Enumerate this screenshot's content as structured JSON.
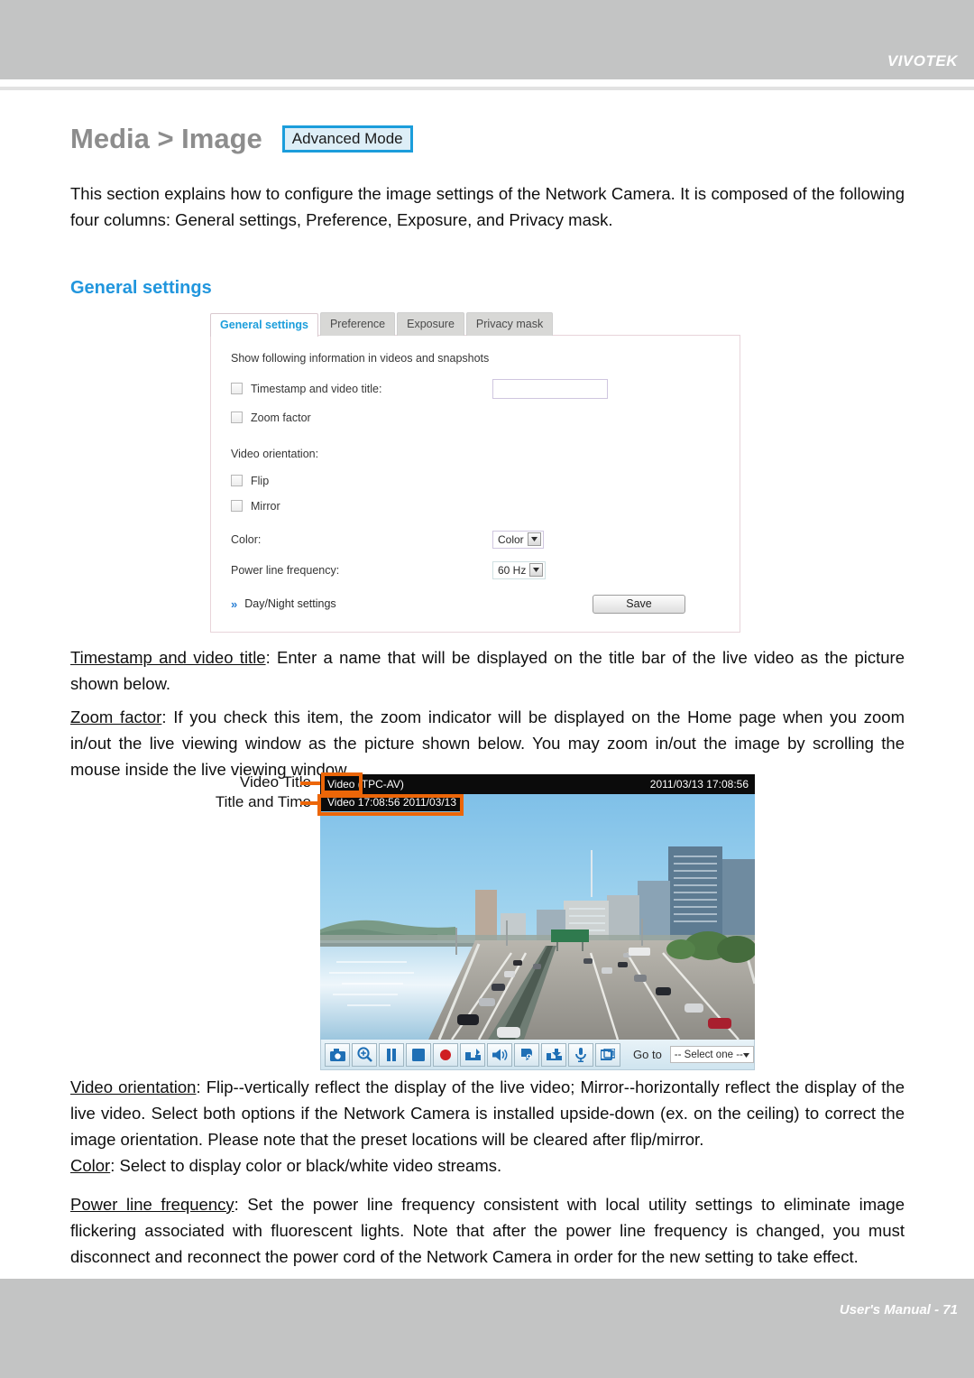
{
  "header": {
    "brand": "VIVOTEK"
  },
  "title": {
    "text": "Media > Image",
    "advanced_mode_button": "Advanced Mode",
    "accent_color": "#1b9ddb"
  },
  "intro_paragraph": "This section explains how to configure the image settings of the Network Camera. It is composed of the following four columns: General settings, Preference, Exposure, and Privacy mask.",
  "section_heading": "General settings",
  "settings_panel": {
    "tabs": [
      {
        "label": "General settings",
        "active": true
      },
      {
        "label": "Preference",
        "active": false
      },
      {
        "label": "Exposure",
        "active": false
      },
      {
        "label": "Privacy mask",
        "active": false
      }
    ],
    "info_label": "Show following information in videos and snapshots",
    "timestamp_checkbox_label": "Timestamp and video title:",
    "timestamp_input_value": "",
    "timestamp_input_placeholder": "",
    "zoom_factor_checkbox_label": "Zoom factor",
    "video_orientation_label": "Video orientation:",
    "flip_checkbox_label": "Flip",
    "mirror_checkbox_label": "Mirror",
    "color_label": "Color:",
    "color_value": "Color",
    "power_line_label": "Power line frequency:",
    "power_line_value": "60 Hz",
    "daynight_link": "Day/Night settings",
    "save_button": "Save"
  },
  "body": {
    "timestamp_term": "Timestamp and video title",
    "timestamp_text": ": Enter a name that will be displayed on the title bar of the live video as the picture shown below.",
    "zoom_term": "Zoom factor",
    "zoom_text": ": If you check this item, the zoom indicator will be displayed on the Home page when you zoom in/out the live viewing window as the picture shown below. You may zoom in/out the image by scrolling the mouse inside the live viewing window.",
    "orientation_term": "Video orientation",
    "orientation_text": ": Flip--vertically reflect the display of the live video; Mirror--horizontally reflect the display of the live video. Select both options if the Network Camera is installed upside-down (ex. on the ceiling) to correct the image orientation. Please note that the preset locations will be cleared after flip/mirror.",
    "color_term": "Color",
    "color_text": ": Select to display color or black/white video streams.",
    "power_term": "Power line frequency",
    "power_text": ": Set the power line frequency consistent with local utility settings to eliminate image flickering associated with fluorescent lights. Note that after the power line frequency is changed, you must disconnect and reconnect the power cord of the Network Camera in order for the new setting to take effect."
  },
  "live_figure": {
    "callout_video_title": "Video Title",
    "callout_title_and_time": "Title and Time",
    "titlebar_name": "Video (TPC-AV)",
    "titlebar_datetime": "2011/03/13  17:08:56",
    "osd_overlay": "Video 17:08:56  2011/03/13",
    "highlight_color": "#ec6608",
    "toolbar_buttons": [
      "snapshot-icon",
      "digital-zoom-icon",
      "pause-icon",
      "stop-icon",
      "record-icon",
      "save-snapshot-icon",
      "speaker-icon",
      "talk-icon",
      "storage-icon",
      "microphone-icon",
      "fullscreen-icon"
    ],
    "goto_label": "Go to",
    "goto_value": "-- Select one --"
  },
  "footer": {
    "text": "User's Manual - 71"
  }
}
